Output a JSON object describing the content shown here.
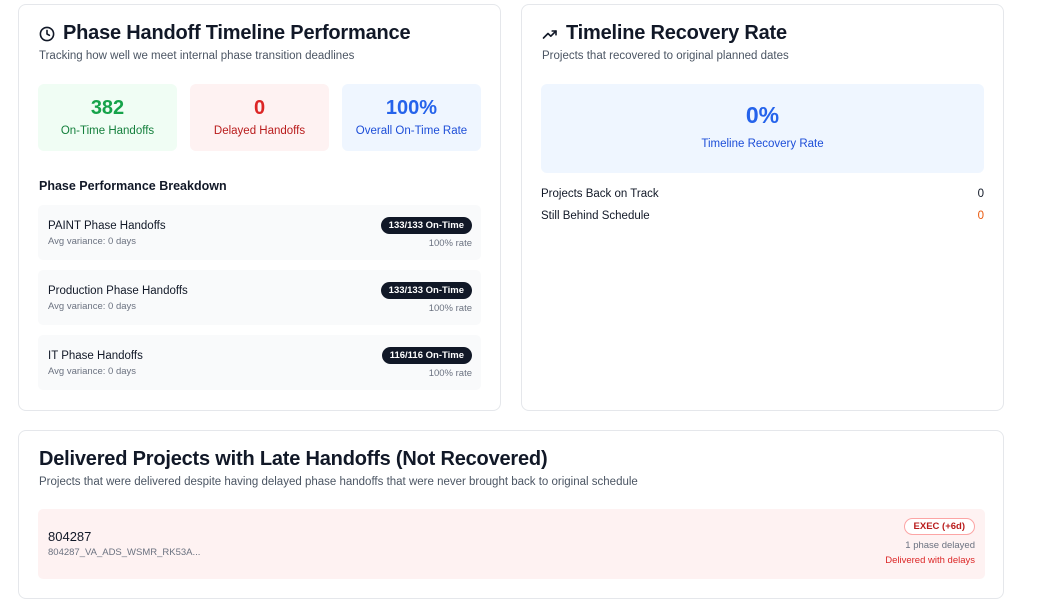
{
  "handoff": {
    "title": "Phase Handoff Timeline Performance",
    "subtitle": "Tracking how well we meet internal phase transition deadlines",
    "icon": "clock-icon",
    "stats": [
      {
        "value": "382",
        "label": "On-Time Handoffs",
        "color": "#16a34a"
      },
      {
        "value": "0",
        "label": "Delayed Handoffs",
        "color": "#dc2626"
      },
      {
        "value": "100%",
        "label": "Overall On-Time Rate",
        "color": "#2563eb"
      }
    ],
    "breakdown_title": "Phase Performance Breakdown",
    "phases": [
      {
        "name": "PAINT Phase Handoffs",
        "variance": "Avg variance: 0 days",
        "badge": "133/133 On-Time",
        "rate": "100% rate"
      },
      {
        "name": "Production Phase Handoffs",
        "variance": "Avg variance: 0 days",
        "badge": "133/133 On-Time",
        "rate": "100% rate"
      },
      {
        "name": "IT Phase Handoffs",
        "variance": "Avg variance: 0 days",
        "badge": "116/116 On-Time",
        "rate": "100% rate"
      }
    ]
  },
  "recovery": {
    "title": "Timeline Recovery Rate",
    "subtitle": "Projects that recovered to original planned dates",
    "icon": "trending-up-icon",
    "rate_value": "0%",
    "rate_label": "Timeline Recovery Rate",
    "rows": [
      {
        "label": "Projects Back on Track",
        "value": "0"
      },
      {
        "label": "Still Behind Schedule",
        "value": "0",
        "color": "#ea580c"
      }
    ]
  },
  "late": {
    "title": "Delivered Projects with Late Handoffs (Not Recovered)",
    "subtitle": "Projects that were delivered despite having delayed phase handoffs that were never brought back to original schedule",
    "projects": [
      {
        "id": "804287",
        "name": "804287_VA_ADS_WSMR_RK53A...",
        "badge": "EXEC (+6d)",
        "delay": "1 phase delayed",
        "status": "Delivered with delays"
      }
    ]
  }
}
